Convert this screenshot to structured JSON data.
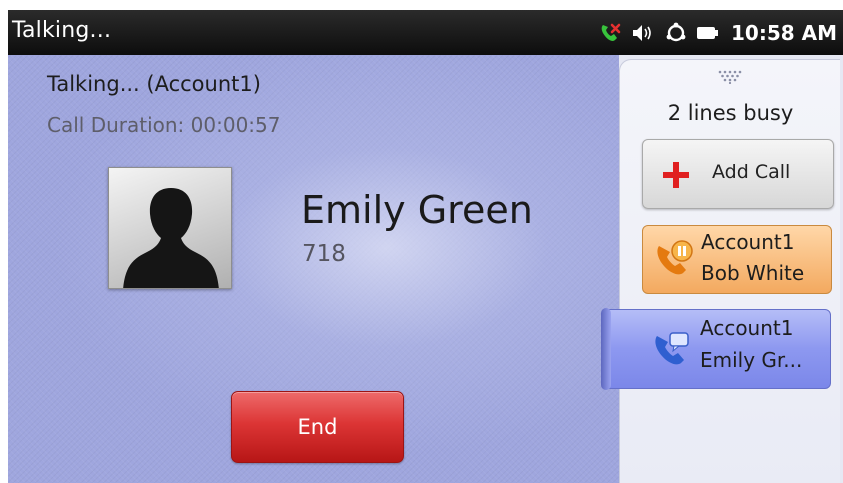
{
  "status_bar": {
    "title": "Talking...",
    "time": "10:58 AM",
    "icons": [
      "missed-call-icon",
      "volume-icon",
      "sync-icon",
      "battery-icon"
    ]
  },
  "call": {
    "status": "Talking... (Account1)",
    "duration": "Call Duration: 00:00:57",
    "contact_name": "Emily Green",
    "contact_number": "718",
    "end_label": "End"
  },
  "lines_panel": {
    "busy_label": "2 lines busy",
    "add_call_label": "Add Call",
    "lines": [
      {
        "account": "Account1",
        "contact": "Bob White",
        "state": "held",
        "icon": "call-on-hold-icon",
        "color": "#f3a95f"
      },
      {
        "account": "Account1",
        "contact": "Emily Gr...",
        "state": "active",
        "icon": "active-call-icon",
        "color": "#8d98f0"
      }
    ]
  },
  "colors": {
    "status_bar": "#111111",
    "main_background": "#9fa6de",
    "end_button": "#dc3535",
    "add_call_plus": "#e02020"
  }
}
